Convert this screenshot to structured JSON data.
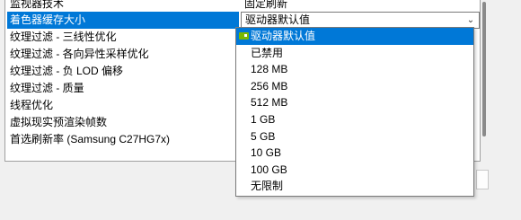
{
  "settings_rows": [
    {
      "name": "监视器技术",
      "value": "固定刷新"
    },
    {
      "name": "着色器缓存大小",
      "value": ""
    },
    {
      "name": "纹理过滤 - 三线性优化",
      "value": ""
    },
    {
      "name": "纹理过滤 - 各向异性采样优化",
      "value": ""
    },
    {
      "name": "纹理过滤 - 负 LOD 偏移",
      "value": ""
    },
    {
      "name": "纹理过滤 - 质量",
      "value": ""
    },
    {
      "name": "线程优化",
      "value": ""
    },
    {
      "name": "虚拟现实预渲染帧数",
      "value": ""
    },
    {
      "name": "首选刷新率 (Samsung C27HG7x)",
      "value": ""
    }
  ],
  "combo": {
    "selected_value": "驱动器默认值",
    "arrow": "chevron-down-icon"
  },
  "dropdown_options": [
    "驱动器默认值",
    "已禁用",
    "128 MB",
    "256 MB",
    "512 MB",
    "1 GB",
    "5 GB",
    "10 GB",
    "100 GB",
    "无限制"
  ],
  "colors": {
    "selection": "#0078d7",
    "nvidia_icon": "#7ab800"
  }
}
